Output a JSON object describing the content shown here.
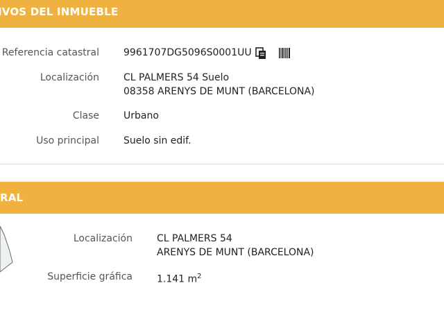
{
  "section1": {
    "title": "IVOS DEL INMUEBLE",
    "rows": [
      {
        "label": "Referencia catastral",
        "value": "9961707DG5096S0001UU"
      },
      {
        "label": "Localización",
        "line1": "CL PALMERS 54 Suelo",
        "line2": "08358 ARENYS DE MUNT (BARCELONA)"
      },
      {
        "label": "Clase",
        "value": "Urbano"
      },
      {
        "label": "Uso principal",
        "value": "Suelo sin edif."
      }
    ],
    "icons": [
      "copy-icon",
      "barcode-icon"
    ]
  },
  "section2": {
    "title": "RAL",
    "rows": [
      {
        "label": "Localización",
        "line1": "CL PALMERS 54",
        "line2": "ARENYS DE MUNT (BARCELONA)"
      },
      {
        "label": "Superficie gráfica",
        "value": "1.141 m",
        "unit_sup": "2"
      }
    ]
  },
  "colors": {
    "header_bar": "#efb13f",
    "header_text": "#ffffff",
    "label_text": "#555555",
    "value_text": "#222222"
  }
}
